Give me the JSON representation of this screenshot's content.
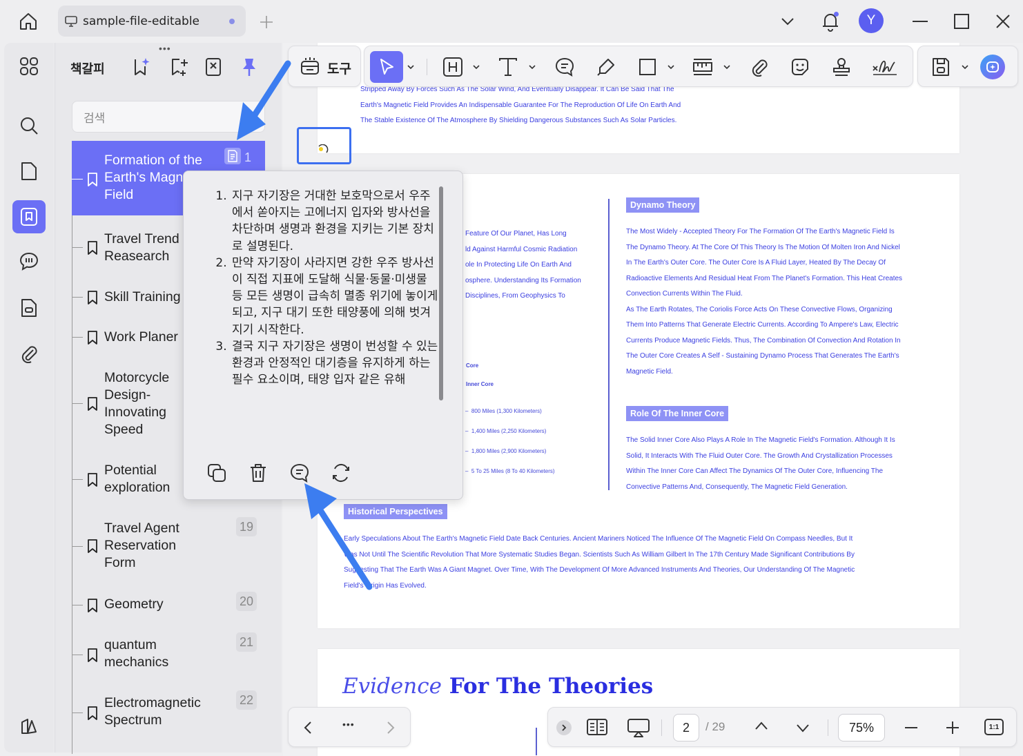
{
  "titlebar": {
    "tab_title": "sample-file-editable",
    "avatar_initial": "Y"
  },
  "panel": {
    "title": "책갈피",
    "more": "•••",
    "search_placeholder": "검색",
    "bookmarks": [
      {
        "label": "Formation of the Earth's Magnetic Field",
        "page": "1",
        "selected": true
      },
      {
        "label": "Travel Trend Reasearch",
        "page": ""
      },
      {
        "label": "Skill Training",
        "page": ""
      },
      {
        "label": "Work Planer",
        "page": ""
      },
      {
        "label": "Motorcycle Design- Innovating Speed",
        "page": ""
      },
      {
        "label": "Potential exploration",
        "page": ""
      },
      {
        "label": "Travel Agent Reservation Form",
        "page": "19"
      },
      {
        "label": "Geometry",
        "page": "20"
      },
      {
        "label": "quantum mechanics",
        "page": "21"
      },
      {
        "label": "Electromagnetic Spectrum",
        "page": "22"
      }
    ]
  },
  "toolbar": {
    "tools_label": "도구"
  },
  "popup": {
    "items": [
      "지구 자기장은 거대한 보호막으로서 우주에서 쏟아지는 고에너지 입자와 방사선을 차단하며 생명과 환경을 지키는 기본 장치로 설명된다.",
      "만약 자기장이 사라지면 강한 우주 방사선이 직접 지표에 도달해 식물·동물·미생물 등 모든 생명이 급속히 멸종 위기에 놓이게 되고, 지구 대기 또한 태양풍에 의해 벗겨지기 시작한다.",
      "결국 지구 자기장은 생명이 번성할 수 있는 환경과 안정적인 대기층을 유지하게 하는 필수 요소이며, 태양 입자 같은 유해"
    ]
  },
  "document": {
    "page1_lines": [
      "Stripped Away By Forces Such As The Solar Wind, And Eventually Disappear. It Can Be Said That The",
      "Earth's Magnetic Field Provides An Indispensable Guarantee For The Reproduction Of Life On Earth And",
      "The Stable Existence Of The Atmosphere By Shielding Dangerous Substances Such As Solar Particles."
    ],
    "left_col_lines": [
      "Feature Of Our Planet, Has Long",
      "ld Against Harmful Cosmic Radiation",
      "ole In Protecting Life On Earth And",
      "osphere. Understanding Its Formation",
      "Disciplines, From Geophysics To"
    ],
    "layer_labels": [
      "Core",
      "Inner Core"
    ],
    "distances": [
      "800 Miles (1,300 Kilometers)",
      "1,400 Miles (2,250 Kilometers)",
      "1,800 Miles (2,900 Kilometers)",
      "5 To 25 Miles (8 To 40 Kilometers)"
    ],
    "dynamo_title": "Dynamo Theory",
    "dynamo_lines": [
      "The Most Widely - Accepted Theory For The Formation Of The Earth's Magnetic Field Is",
      "The Dynamo Theory. At The Core Of This Theory Is The Motion Of Molten Iron And Nickel",
      "In The Earth's Outer Core. The Outer Core Is A Fluid Layer, Heated By The Decay Of",
      "Radioactive Elements And Residual Heat From The Planet's Formation. This Heat Creates",
      "Convection Currents Within The Fluid.",
      "As The Earth Rotates, The Coriolis Force Acts On These Convective Flows, Organizing",
      "Them Into Patterns That Generate Electric Currents. According To Ampere's Law, Electric",
      "Currents Produce Magnetic Fields. Thus, The Combination Of Convection And Rotation In",
      "The Outer Core Creates A Self - Sustaining Dynamo Process That Generates The Earth's",
      "Magnetic Field."
    ],
    "inner_core_title": "Role Of The Inner Core",
    "inner_core_lines": [
      "The Solid Inner Core Also Plays A Role In The Magnetic Field's Formation. Although It Is",
      "Solid, It Interacts With The Fluid Outer Core. The Growth And Crystallization Processes",
      "Within The Inner Core Can Affect The Dynamics Of The Outer Core, Influencing The",
      "Convective Patterns And, Consequently, The Magnetic Field Generation."
    ],
    "historical_title": "Historical Perspectives",
    "historical_lines": [
      "Early Speculations About The Earth's Magnetic Field Date Back Centuries. Ancient Mariners Noticed The Influence Of The Magnetic Field On Compass Needles, But It",
      "Was Not Until The Scientific Revolution That More Systematic Studies Began. Scientists Such As William Gilbert In The 17th Century Made Significant Contributions By",
      "Suggesting That The Earth Was A Giant Magnet. Over Time, With The Development Of More Advanced Instruments And Theories, Our Understanding Of The Magnetic",
      "Field's Origin Has Evolved."
    ],
    "evidence_italic": "Evidence",
    "evidence_rest": " For The Theories"
  },
  "bottom": {
    "more": "•••",
    "current_page": "2",
    "total_pages": "/ 29",
    "zoom": "75%",
    "fit_label": "1:1"
  },
  "colors": {
    "accent": "#6b6ff5",
    "doc_text": "#3a3ee0",
    "arrow": "#3c7df0"
  }
}
